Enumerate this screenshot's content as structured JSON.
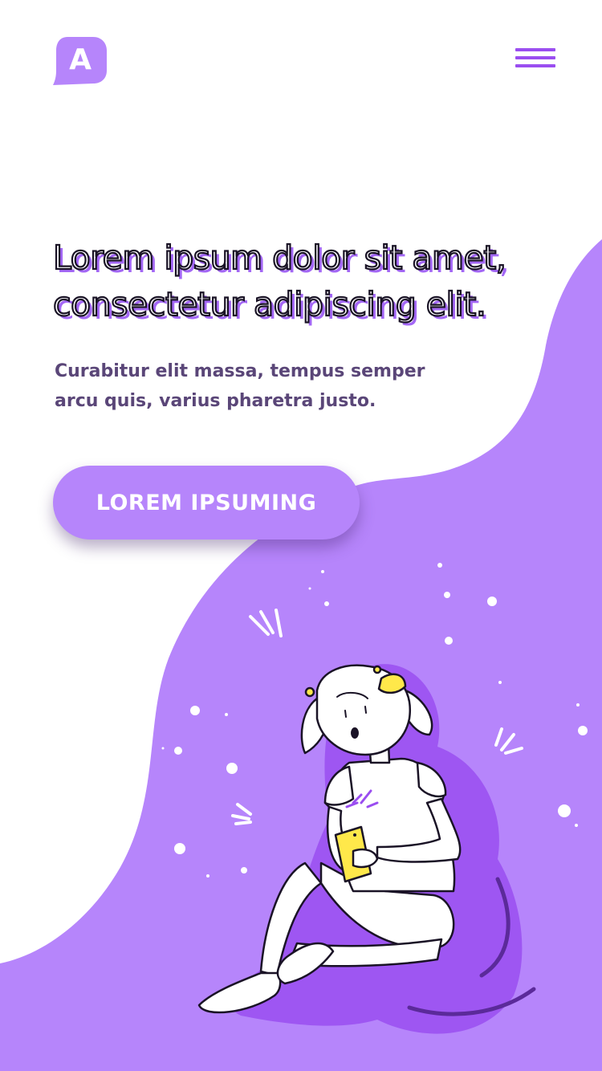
{
  "brand": {
    "logo_letter": "A",
    "logo_icon": "speech-bubble-logo-icon"
  },
  "header": {
    "menu_icon": "hamburger-menu-icon"
  },
  "hero": {
    "headline_line1": "Lorem ipsum dolor sit amet,",
    "headline_line2": "consectetur adipiscing elit.",
    "subtext_line1": "Curabitur elit massa, tempus semper",
    "subtext_line2": "arcu quis, varius pharetra justo.",
    "cta_label": "LOREM IPSUMING"
  },
  "illustration": {
    "subject": "girl-with-phone-illustration",
    "accent_colors": [
      "#ffe84a",
      "#9a4df0"
    ]
  },
  "colors": {
    "primary": "#b685fb",
    "primary_dark": "#9a4df0",
    "text_muted": "#5a4678",
    "headline_stroke": "#1a1326",
    "background": "#ffffff"
  }
}
